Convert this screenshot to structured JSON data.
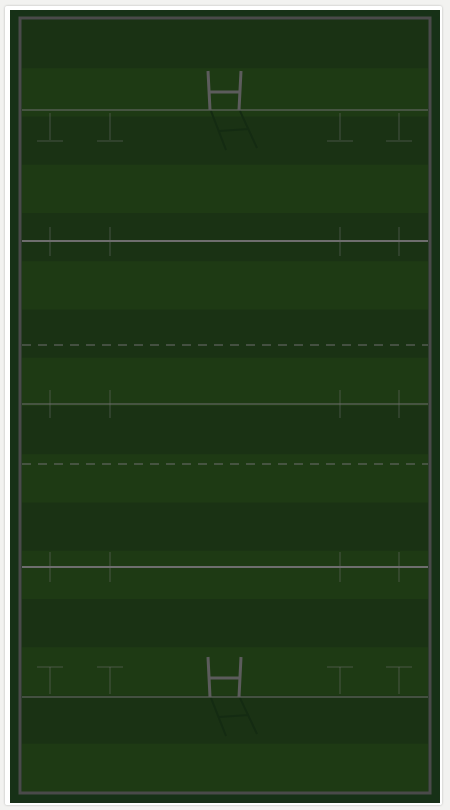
{
  "pitch": {
    "type": "rugby-pitch",
    "orientation": "vertical",
    "colors": {
      "surround": "#173117",
      "stripe_dark": "#1a3214",
      "stripe_light": "#1e3a14",
      "boundary": "#4a4a4a",
      "line": "#6e6e6e",
      "goalpost": "#5c5c5c",
      "post_shadow": "#142b12",
      "frame": "#ffffff",
      "page": "#f2f2f0"
    },
    "markings": {
      "try_lines": 2,
      "twenty_two_lines": 2,
      "halfway_line": true,
      "ten_metre_dashed_lines": 2,
      "five_metre_dashed_lines": false,
      "goalposts": 2,
      "stripes": 16
    }
  }
}
